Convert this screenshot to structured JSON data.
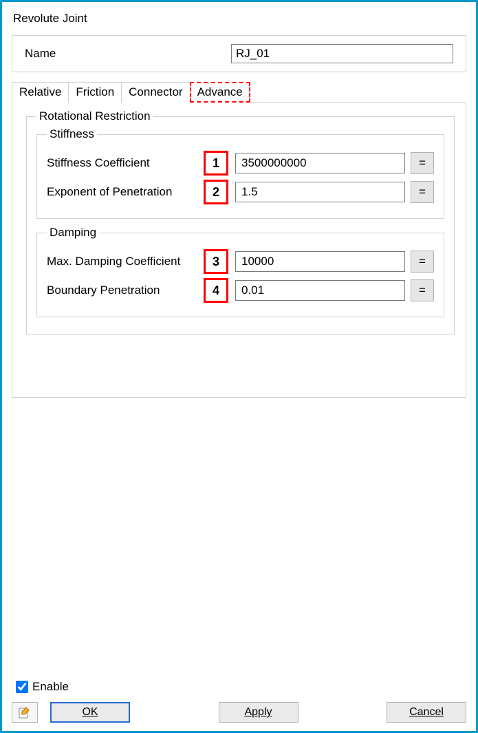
{
  "title": "Revolute Joint",
  "name": {
    "label": "Name",
    "value": "RJ_01"
  },
  "tabs": [
    {
      "label": "Relative"
    },
    {
      "label": "Friction"
    },
    {
      "label": "Connector"
    },
    {
      "label": "Advance"
    }
  ],
  "groups": {
    "outer": "Rotational Restriction",
    "stiffness": {
      "legend": "Stiffness",
      "fields": [
        {
          "num": "1",
          "label": "Stiffness Coefficient",
          "value": "3500000000"
        },
        {
          "num": "2",
          "label": "Exponent of Penetration",
          "value": "1.5"
        }
      ]
    },
    "damping": {
      "legend": "Damping",
      "fields": [
        {
          "num": "3",
          "label": "Max. Damping Coefficient",
          "value": "10000"
        },
        {
          "num": "4",
          "label": "Boundary Penetration",
          "value": "0.01"
        }
      ]
    }
  },
  "eq_glyph": "=",
  "enable": {
    "label": "Enable",
    "checked": true
  },
  "buttons": {
    "ok": "OK",
    "apply": "Apply",
    "cancel": "Cancel"
  }
}
